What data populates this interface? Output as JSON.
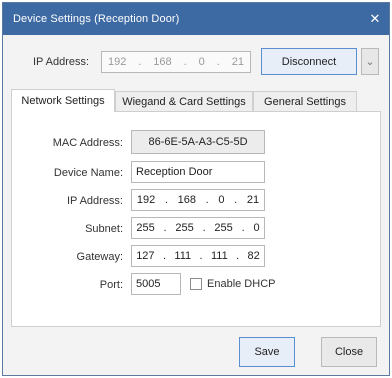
{
  "window": {
    "title": "Device Settings (Reception Door)",
    "close_glyph": "✕"
  },
  "topbar": {
    "ip_label": "IP Address:",
    "ip_octets": [
      "192",
      "168",
      "0",
      "21"
    ],
    "ip_sep": ".",
    "disconnect_label": "Disconnect",
    "dropdown_glyph": "⌄"
  },
  "tabs": [
    {
      "label": "Network Settings",
      "active": true
    },
    {
      "label": "Wiegand & Card Settings",
      "active": false
    },
    {
      "label": "General Settings",
      "active": false
    }
  ],
  "network": {
    "mac_label": "MAC Address:",
    "mac_value": "86-6E-5A-A3-C5-5D",
    "name_label": "Device Name:",
    "name_value": "Reception Door",
    "ip_label": "IP Address:",
    "ip_octets": [
      "192",
      "168",
      "0",
      "21"
    ],
    "subnet_label": "Subnet:",
    "subnet_octets": [
      "255",
      "255",
      "255",
      "0"
    ],
    "gateway_label": "Gateway:",
    "gateway_octets": [
      "127",
      "111",
      "111",
      "82"
    ],
    "port_label": "Port:",
    "port_value": "5005",
    "dhcp_label": "Enable DHCP",
    "dhcp_checked": false,
    "sep": "."
  },
  "footer": {
    "save_label": "Save",
    "close_label": "Close"
  },
  "colors": {
    "titlebar": "#3e6aa3",
    "accent_border": "#5b8fd1"
  }
}
